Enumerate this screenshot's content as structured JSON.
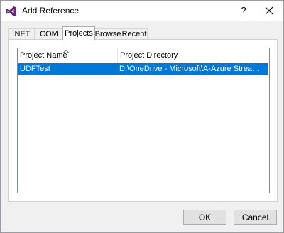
{
  "window": {
    "title": "Add Reference",
    "help_label": "?"
  },
  "tabs": [
    {
      "label": ".NET",
      "active": false
    },
    {
      "label": "COM",
      "active": false
    },
    {
      "label": "Projects",
      "active": true
    },
    {
      "label": "Browse",
      "active": false
    },
    {
      "label": "Recent",
      "active": false
    }
  ],
  "list": {
    "columns": [
      "Project Name",
      "Project Directory"
    ],
    "sorted_column": "Project Name",
    "rows": [
      {
        "name": "UDFTest",
        "directory": "D:\\OneDrive - Microsoft\\A-Azure Stream Anal...",
        "selected": true
      }
    ]
  },
  "buttons": {
    "ok": "OK",
    "cancel": "Cancel"
  },
  "colors": {
    "selection": "#0078d7",
    "vs_icon": "#68217a"
  },
  "icons": [
    "visual-studio-icon",
    "close-icon",
    "sort-ascending-icon"
  ]
}
